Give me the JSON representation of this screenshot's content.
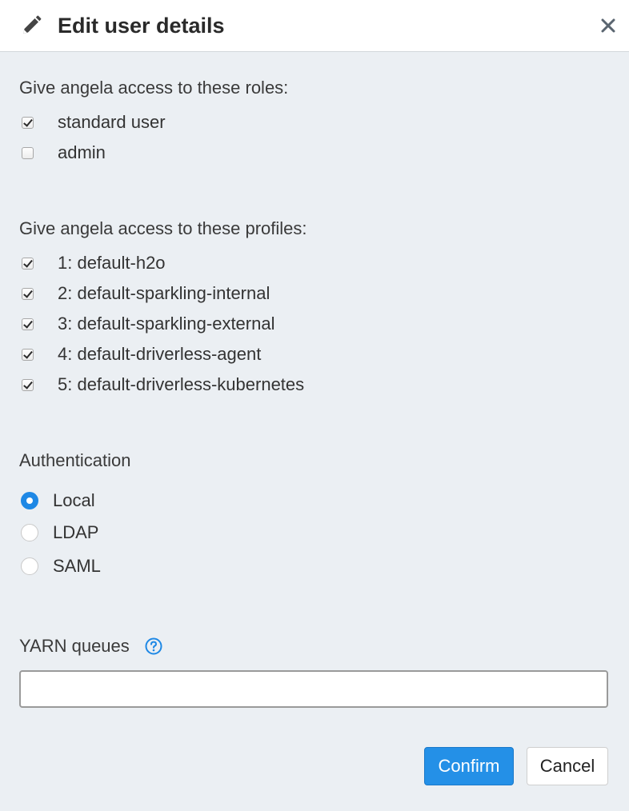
{
  "header": {
    "title": "Edit user details",
    "icon": "pencil-icon",
    "close_icon": "close-icon"
  },
  "roles": {
    "label": "Give angela access to these roles:",
    "items": [
      {
        "label": "standard user",
        "checked": true
      },
      {
        "label": "admin",
        "checked": false
      }
    ]
  },
  "profiles": {
    "label": "Give angela access to these profiles:",
    "items": [
      {
        "label": "1: default-h2o",
        "checked": true
      },
      {
        "label": "2: default-sparkling-internal",
        "checked": true
      },
      {
        "label": "3: default-sparkling-external",
        "checked": true
      },
      {
        "label": "4: default-driverless-agent",
        "checked": true
      },
      {
        "label": "5: default-driverless-kubernetes",
        "checked": true
      }
    ]
  },
  "authentication": {
    "label": "Authentication",
    "selected": "Local",
    "options": [
      {
        "label": "Local"
      },
      {
        "label": "LDAP"
      },
      {
        "label": "SAML"
      }
    ]
  },
  "yarn": {
    "label": "YARN queues",
    "help_icon": "help-icon",
    "value": "",
    "placeholder": ""
  },
  "buttons": {
    "confirm": "Confirm",
    "cancel": "Cancel"
  },
  "colors": {
    "accent": "#2490e7",
    "background": "#ebeff3"
  }
}
